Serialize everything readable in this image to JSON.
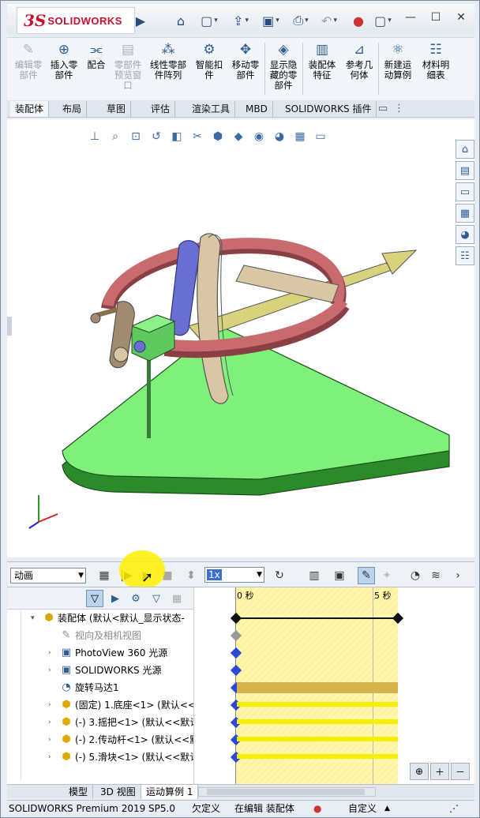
{
  "app": {
    "logo_ds": "3S",
    "logo_text": "SOLIDWORKS"
  },
  "ribbon": [
    {
      "label": "编辑零\n部件",
      "icon": "edit-component-icon",
      "enabled": false
    },
    {
      "label": "插入零\n部件",
      "icon": "insert-component-icon",
      "enabled": true
    },
    {
      "label": "配合",
      "icon": "mate-icon",
      "enabled": true
    },
    {
      "label": "零部件\n预览窗\n口",
      "icon": "component-preview-icon",
      "enabled": false
    },
    {
      "label": "线性零部\n件阵列",
      "icon": "linear-pattern-icon",
      "enabled": true
    },
    {
      "label": "智能扣\n件",
      "icon": "smart-fastener-icon",
      "enabled": true
    },
    {
      "label": "移动零\n部件",
      "icon": "move-component-icon",
      "enabled": true
    },
    {
      "label": "显示隐\n藏的零\n部件",
      "icon": "show-hidden-icon",
      "enabled": true
    },
    {
      "label": "装配体\n特征",
      "icon": "assembly-feature-icon",
      "enabled": true
    },
    {
      "label": "参考几\n何体",
      "icon": "reference-geometry-icon",
      "enabled": true
    },
    {
      "label": "新建运\n动算例",
      "icon": "new-motion-study-icon",
      "enabled": true
    },
    {
      "label": "材料明\n细表",
      "icon": "bom-icon",
      "enabled": true
    }
  ],
  "tabs": [
    "装配体",
    "布局",
    "草图",
    "评估",
    "渲染工具",
    "MBD",
    "SOLIDWORKS 插件"
  ],
  "motion": {
    "study_type": "动画",
    "speed": "1x"
  },
  "timeline": {
    "label_start": "0 秒",
    "label_end": "5 秒"
  },
  "tree": [
    {
      "label": "装配体 (默认<默认_显示状态-",
      "level": 0,
      "expander": "▾",
      "icon": "assembly-icon"
    },
    {
      "label": "视向及相机视图",
      "level": 1,
      "expander": "",
      "icon": "camera-view-icon",
      "dim": true
    },
    {
      "label": "PhotoView 360 光源",
      "level": 1,
      "expander": "›",
      "icon": "photoview-light-icon"
    },
    {
      "label": "SOLIDWORKS 光源",
      "level": 1,
      "expander": "›",
      "icon": "sw-light-icon"
    },
    {
      "label": "旋转马达1",
      "level": 1,
      "expander": "",
      "icon": "rotary-motor-icon"
    },
    {
      "label": "(固定) 1.底座<1> (默认<<",
      "level": 1,
      "expander": "›",
      "icon": "part-icon"
    },
    {
      "label": "(-) 3.摇把<1> (默认<<默认",
      "level": 1,
      "expander": "›",
      "icon": "part-icon"
    },
    {
      "label": "(-) 2.传动杆<1> (默认<<默",
      "level": 1,
      "expander": "›",
      "icon": "part-icon"
    },
    {
      "label": "(-) 5.滑块<1> (默认<<默认",
      "level": 1,
      "expander": "›",
      "icon": "part-icon"
    }
  ],
  "bottom_tabs": [
    "模型",
    "3D 视图",
    "运动算例 1"
  ],
  "status": {
    "product": "SOLIDWORKS Premium 2019 SP5.0",
    "definition": "欠定义",
    "mode": "在编辑 装配体",
    "custom": "自定义"
  },
  "colors": {
    "base": "#7ff07a",
    "ring": "#c96a6e",
    "arm": "#d9c6a4",
    "slider": "#6a6fd4",
    "rod": "#d9d27c",
    "timeline_motor": "#d6b24a",
    "timeline_part": "#f5f000"
  }
}
